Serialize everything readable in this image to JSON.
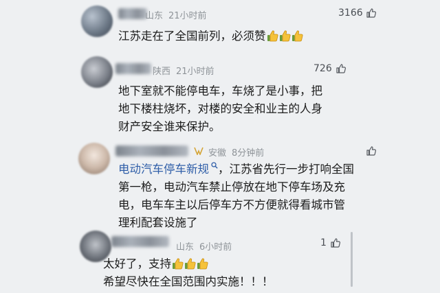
{
  "comments": [
    {
      "location": "山东",
      "time": "21小时前",
      "likes": "3166",
      "lines": [
        "江苏走在了全国前列，必须赞"
      ],
      "emoji_count": 3
    },
    {
      "location": "陕西",
      "time": "21小时前",
      "likes": "726",
      "lines": [
        "地下室就不能停电车，车烧了是小事，把",
        "地下楼柱烧坏，对楼的安全和业主的人身",
        "财产安全谁来保护。"
      ]
    },
    {
      "location": "安徽",
      "time": "8分钟前",
      "likes": "",
      "link": "电动汽车停车新规",
      "line1_rest": "，江苏省先行一步打响全国",
      "lines": [
        "第一枪，电动汽车禁止停放在地下停车场及充",
        "电，电车车主以后停车方不方便就得看城市管",
        "理利配套设施了"
      ]
    },
    {
      "location": "山东",
      "time": "6小时前",
      "likes": "1",
      "lines": [
        "太好了，支持",
        "希望尽快在全国范围内实施！！！"
      ],
      "emoji_count": 3
    }
  ],
  "colors": {
    "link": "#2f5ea8",
    "meta": "#8e9398",
    "background": "#eef0f2"
  },
  "icons": [
    "thumbs-up-icon",
    "thumbs-up-emoji",
    "search-icon",
    "medal-badge-icon"
  ]
}
